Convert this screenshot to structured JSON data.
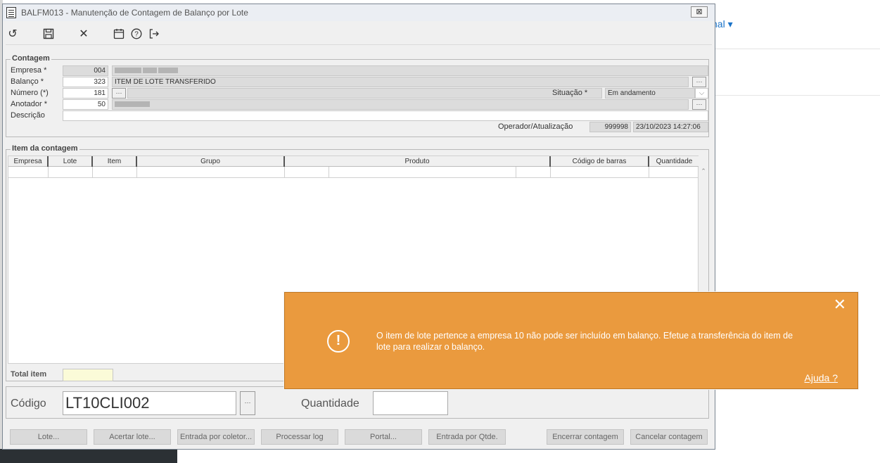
{
  "background": {
    "menu_label": "nal ▾"
  },
  "window": {
    "title": "BALFM013 - Manutenção de Contagem de Balanço por Lote",
    "close_glyph": "⊠"
  },
  "toolbar": {
    "icons": [
      "undo-icon",
      "save-icon",
      "close-icon",
      "calendar-icon",
      "help-icon",
      "exit-icon"
    ],
    "glyphs": {
      "undo": "↺",
      "save": "💾",
      "close": "✕",
      "calendar": "▦",
      "help": "?",
      "exit": "⇥"
    }
  },
  "contagem": {
    "title": "Contagem",
    "empresa_label": "Empresa *",
    "empresa_value": "004",
    "balanco_label": "Balanço *",
    "balanco_value": "323",
    "balanco_desc": "ITEM DE LOTE TRANSFERIDO",
    "numero_label": "Número (*)",
    "numero_value": "181",
    "situacao_label": "Situação *",
    "situacao_value": "Em andamento",
    "anotador_label": "Anotador *",
    "anotador_value": "50",
    "descricao_label": "Descrição",
    "operador_label": "Operador/Atualização",
    "operador_value": "999998",
    "atualizacao_value": "23/10/2023 14:27:06"
  },
  "itens": {
    "title": "Item da contagem",
    "columns": [
      "Empresa",
      "Lote",
      "Item",
      "Grupo",
      "Produto",
      "Código de barras",
      "Quantidade"
    ],
    "total_label": "Total item",
    "total_value": ""
  },
  "entrada": {
    "codigo_label": "Código",
    "codigo_value": "LT10CLI002",
    "quantidade_label": "Quantidade",
    "quantidade_value": ""
  },
  "buttons": {
    "lote": "Lote...",
    "acertar": "Acertar lote...",
    "coletor": "Entrada por coletor...",
    "processar": "Processar log",
    "portal": "Portal...",
    "qtde": "Entrada por Qtde.",
    "encerrar": "Encerrar contagem",
    "cancelar": "Cancelar contagem"
  },
  "toast": {
    "message": "O item de lote pertence a empresa 10 não pode ser incluído em balanço. Efetue a transferência do item de lote para realizar o balanço.",
    "help_link": "Ajuda ?",
    "icon_glyph": "!",
    "close_glyph": "✕",
    "color": "#ea9a3e"
  }
}
